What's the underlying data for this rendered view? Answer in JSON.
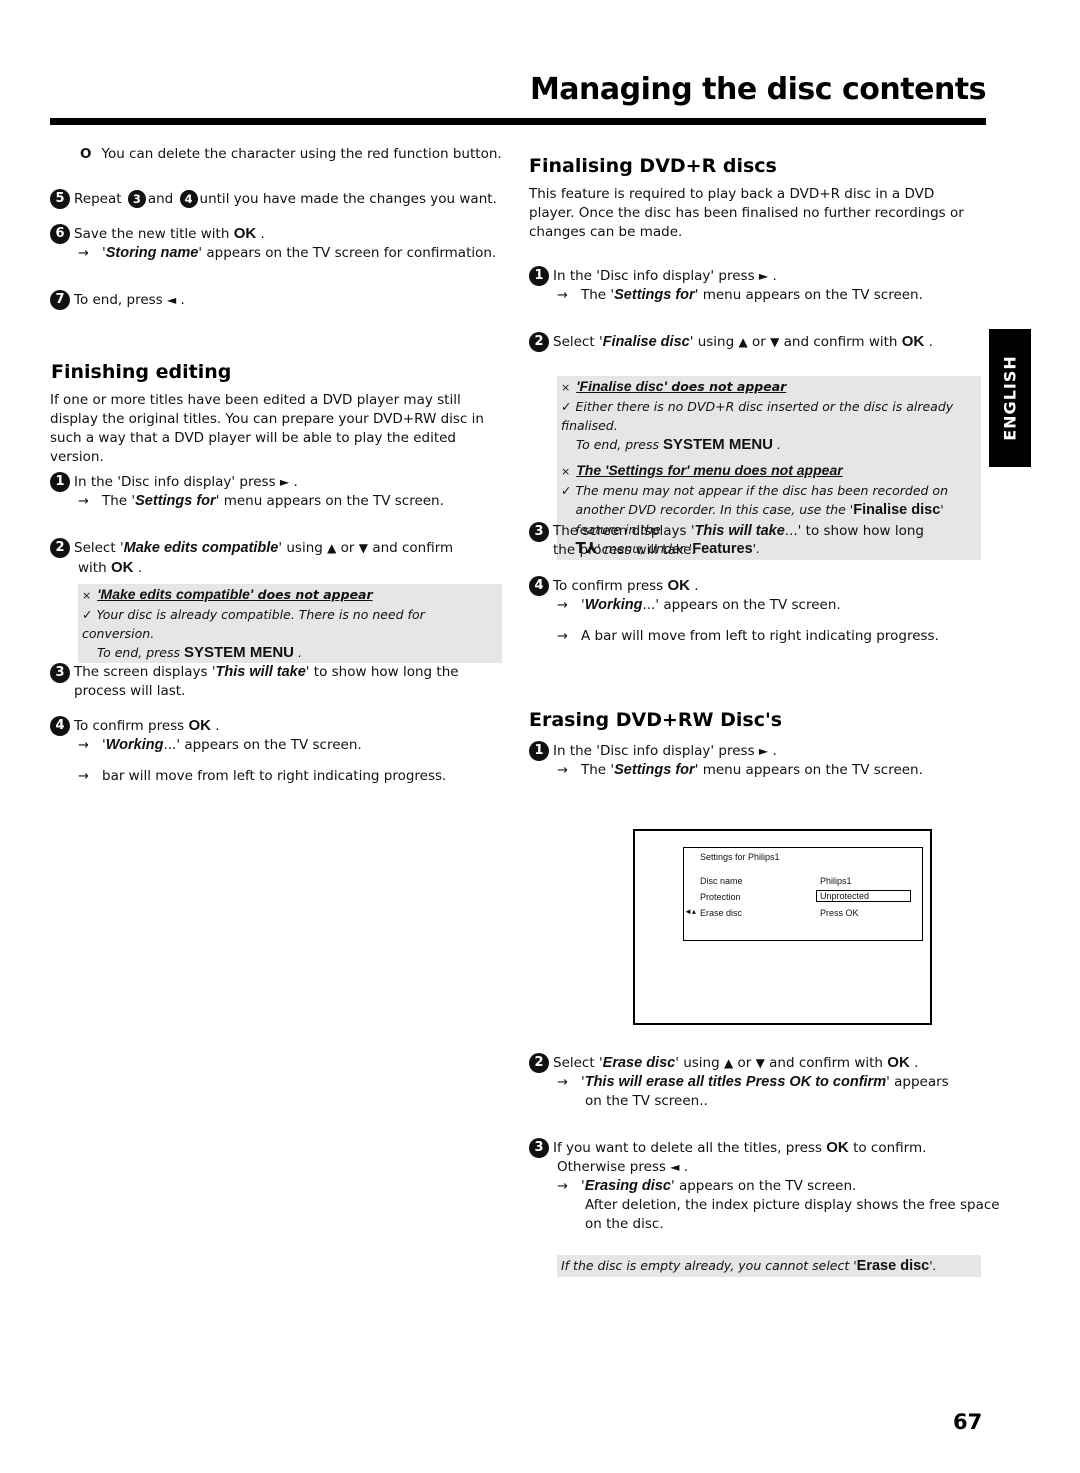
{
  "header": {
    "title": "Managing the disc contents"
  },
  "side_tab": {
    "label": "ENGLISH"
  },
  "page_number": "67",
  "left": {
    "tip": {
      "bullet": "O",
      "text": "You can delete the character using the red function button."
    },
    "step5": {
      "num": "5",
      "a": "Repeat",
      "ref1": "3",
      "b": "and",
      "ref2": "4",
      "c": "until you have made the changes you want."
    },
    "step6": {
      "num": "6",
      "text": "Save the new title with",
      "key": "OK",
      "end": ".",
      "arrow": "→",
      "em": "Storing name",
      "result": "' appears on the TV screen for confirmation."
    },
    "step7": {
      "num": "7",
      "text": "To end, press",
      "icon": "◄",
      "end": "."
    },
    "finishing": {
      "heading": "Finishing editing",
      "intro": "If one or more titles have been edited a DVD player may still display the original titles. You can prepare your DVD+RW disc in such a way that a DVD player will be able to play the edited version.",
      "step1": {
        "num": "1",
        "text": "In the 'Disc info display' press",
        "icon": "►",
        "end": ".",
        "arrow": "→",
        "pre": "The '",
        "em": "Settings for",
        "result": "' menu appears on the TV screen."
      },
      "step2": {
        "num": "2",
        "pre": "Select '",
        "em": "Make edits compatible",
        "mid": "' using",
        "up": "▲",
        "or": "or",
        "down": "▼",
        "post": "and confirm",
        "line2": "with",
        "key": "OK",
        "end": "."
      },
      "note": {
        "x": "×",
        "title_em": "'Make edits compatible'",
        "title_rest": " does not appear",
        "check": "✓",
        "text": "Your disc is already compatible. There is no need for conversion.",
        "end_text": "To end, press",
        "key": "SYSTEM MENU",
        "end": "."
      },
      "step3": {
        "num": "3",
        "pre": "The screen displays '",
        "em": "This will take",
        "post": "' to show how long the process will last."
      },
      "step4": {
        "num": "4",
        "text": "To confirm press",
        "key": "OK",
        "end": ".",
        "arrow": "→",
        "em": "Working",
        "result": "...' appears on the TV screen.",
        "arrow2": "→",
        "result2": "bar will move from left to right indicating progress."
      }
    }
  },
  "right": {
    "finalising": {
      "heading": "Finalising DVD+R discs",
      "intro": "This feature is required to play back a DVD+R disc in a DVD player. Once the disc has been finalised no further recordings or changes can be made.",
      "step1": {
        "num": "1",
        "text": "In the 'Disc info display' press",
        "icon": "►",
        "end": ".",
        "arrow": "→",
        "pre": "The '",
        "em": "Settings for",
        "result": "' menu appears on the TV screen."
      },
      "step2": {
        "num": "2",
        "pre": "Select '",
        "em": "Finalise disc",
        "mid": "' using",
        "up": "▲",
        "or": "or",
        "down": "▼",
        "post": "and confirm with",
        "key": "OK",
        "end": "."
      },
      "note": {
        "x1": "×",
        "title1_em": "'Finalise disc'",
        "title1_rest": " does not appear",
        "check1": "✓",
        "text1": "Either there is no DVD+R disc inserted or the disc is already finalised.",
        "end_text": "To end, press",
        "key": "SYSTEM MENU",
        "end": ".",
        "x2": "×",
        "title2": "The 'Settings for' menu does not appear",
        "check2": "✓",
        "text2a": "The menu may not appear if the disc has been recorded on another DVD recorder. In this case, use the '",
        "text2_em": "Finalise disc",
        "text2b": "' feature in the",
        "tools_icon": "T⅄",
        "text2c": "' menu, under '",
        "features_em": "Features",
        "text2d": "'."
      },
      "step3": {
        "num": "3",
        "pre": "The screen displays '",
        "em": "This will take",
        "post": "...' to show how long the process will take."
      },
      "step4": {
        "num": "4",
        "text": "To confirm press",
        "key": "OK",
        "end": ".",
        "arrow": "→",
        "em": "Working",
        "result": "...' appears on the TV screen.",
        "arrow2": "→",
        "result2": "A bar will move from left to right indicating progress."
      }
    },
    "erasing": {
      "heading": "Erasing DVD+RW Disc's",
      "step1": {
        "num": "1",
        "text": "In the 'Disc info display' press",
        "icon": "►",
        "end": ".",
        "arrow": "→",
        "pre": "The '",
        "em": "Settings for",
        "result": "' menu appears on the TV screen."
      },
      "tv_screen": {
        "title": "Settings for Philips1",
        "rows": [
          {
            "label": "Disc name",
            "value": "Philips1"
          },
          {
            "label": "Protection",
            "value": "Unprotected"
          },
          {
            "label": "Erase disc",
            "value": "Press OK"
          }
        ],
        "pointer": "◄▴"
      },
      "step2": {
        "num": "2",
        "pre": "Select '",
        "em": "Erase disc",
        "mid": "' using",
        "up": "▲",
        "or": "or",
        "down": "▼",
        "post": "and confirm with",
        "key": "OK",
        "end": ".",
        "arrow": "→",
        "em2": "This will erase all titles  Press OK to confirm",
        "result": "' appears",
        "result_line2": "on the TV screen.."
      },
      "step3": {
        "num": "3",
        "text": "If you want to delete all the titles, press",
        "key": "OK",
        "post": "to confirm.",
        "line2": "Otherwise press",
        "icon": "◄",
        "end": ".",
        "arrow": "→",
        "em": "Erasing disc",
        "result": "' appears on the TV screen.",
        "after1": "After deletion, the index picture display shows the free space",
        "after2": "on the disc."
      },
      "note": {
        "text": "If the disc is empty already, you cannot select '",
        "em": "Erase disc",
        "end": "'."
      }
    }
  }
}
